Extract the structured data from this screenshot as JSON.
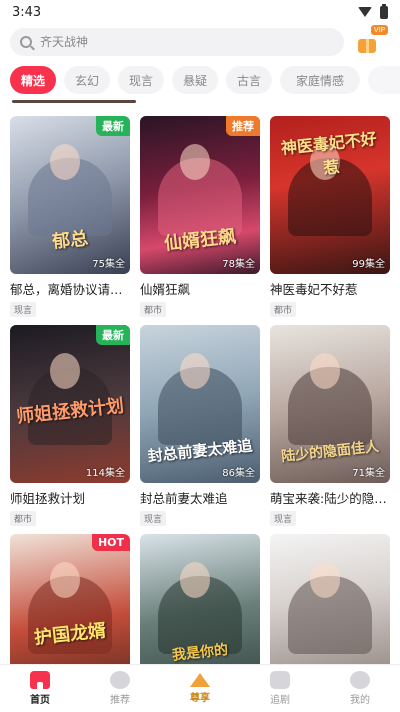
{
  "status": {
    "time": "3:43"
  },
  "search": {
    "placeholder": "齐天战神",
    "value": ""
  },
  "vip": {
    "tag": "VIP"
  },
  "tabs": [
    "精选",
    "玄幻",
    "现言",
    "悬疑",
    "古言",
    "家庭情感",
    ""
  ],
  "dramas": [
    {
      "title": "郁总，离婚协议请签收",
      "tag": "现言",
      "episodes": "75集全",
      "badge": "最新",
      "badge_color": "green",
      "calligraphy": "郁总"
    },
    {
      "title": "仙婿狂飙",
      "tag": "都市",
      "episodes": "78集全",
      "badge": "推荐",
      "badge_color": "orange",
      "calligraphy": "仙婿狂飙"
    },
    {
      "title": "神医毒妃不好惹",
      "tag": "都市",
      "episodes": "99集全",
      "badge": "",
      "badge_color": "",
      "calligraphy": "神医毒妃不好惹"
    },
    {
      "title": "师姐拯救计划",
      "tag": "都市",
      "episodes": "114集全",
      "badge": "最新",
      "badge_color": "green",
      "calligraphy": "师姐拯救计划"
    },
    {
      "title": "封总前妻太难追",
      "tag": "现言",
      "episodes": "86集全",
      "badge": "",
      "badge_color": "",
      "calligraphy": "封总前妻太难追"
    },
    {
      "title": "萌宝来袭:陆少的隐面…",
      "tag": "现言",
      "episodes": "71集全",
      "badge": "",
      "badge_color": "",
      "calligraphy": "陆少的隐面佳人"
    },
    {
      "title": "",
      "tag": "",
      "episodes": "",
      "badge": "HOT",
      "badge_color": "red",
      "calligraphy": "护国龙婿"
    },
    {
      "title": "",
      "tag": "",
      "episodes": "",
      "badge": "",
      "badge_color": "",
      "calligraphy": "我是你的"
    },
    {
      "title": "",
      "tag": "",
      "episodes": "",
      "badge": "",
      "badge_color": "",
      "calligraphy": ""
    }
  ],
  "nav": [
    {
      "label": "首页",
      "icon": "home-icon"
    },
    {
      "label": "推荐",
      "icon": "recommend-icon"
    },
    {
      "label": "尊享",
      "icon": "crown-icon"
    },
    {
      "label": "追剧",
      "icon": "tv-icon"
    },
    {
      "label": "我的",
      "icon": "profile-icon"
    }
  ],
  "colors": {
    "accent": "#f8324d",
    "premium": "#f0a23a"
  }
}
